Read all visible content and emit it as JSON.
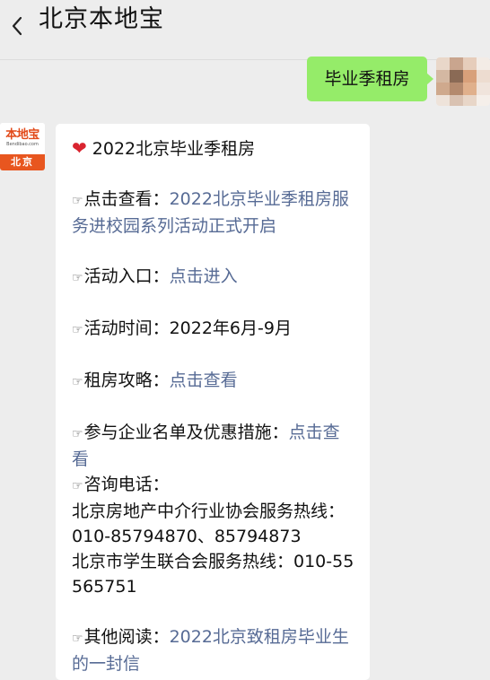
{
  "header": {
    "title": "北京本地宝"
  },
  "me": {
    "message": "毕业季租房"
  },
  "official_account": {
    "logo_text": "本地宝",
    "logo_sub": "Bendibao.com",
    "logo_city": "北京"
  },
  "article": {
    "title_icon": "heart-icon",
    "title": "2022北京毕业季租房",
    "pointer_glyph": "☞",
    "check_label": "点击查看：",
    "check_link": "2022北京毕业季租房服务进校园系列活动正式开启",
    "entry_label": "活动入口：",
    "entry_link": "点击进入",
    "time_label": "活动时间：",
    "time_value": "2022年6月-9月",
    "guide_label": "租房攻略：",
    "guide_link": "点击查看",
    "companies_label": "参与企业名单及优惠措施：",
    "companies_link": "点击查看",
    "hotline_label": "咨询电话：",
    "hotline_line1": "北京房地产中介行业协会服务热线：010-85794870、85794873",
    "hotline_line2": "北京市学生联合会服务热线：010-55565751",
    "other_label": "其他阅读：",
    "other_link": "2022北京致租房毕业生的一封信"
  },
  "colors": {
    "link": "#576b95",
    "my_bubble": "#95ec69",
    "background": "#ededed",
    "logo_orange": "#e8561f"
  }
}
